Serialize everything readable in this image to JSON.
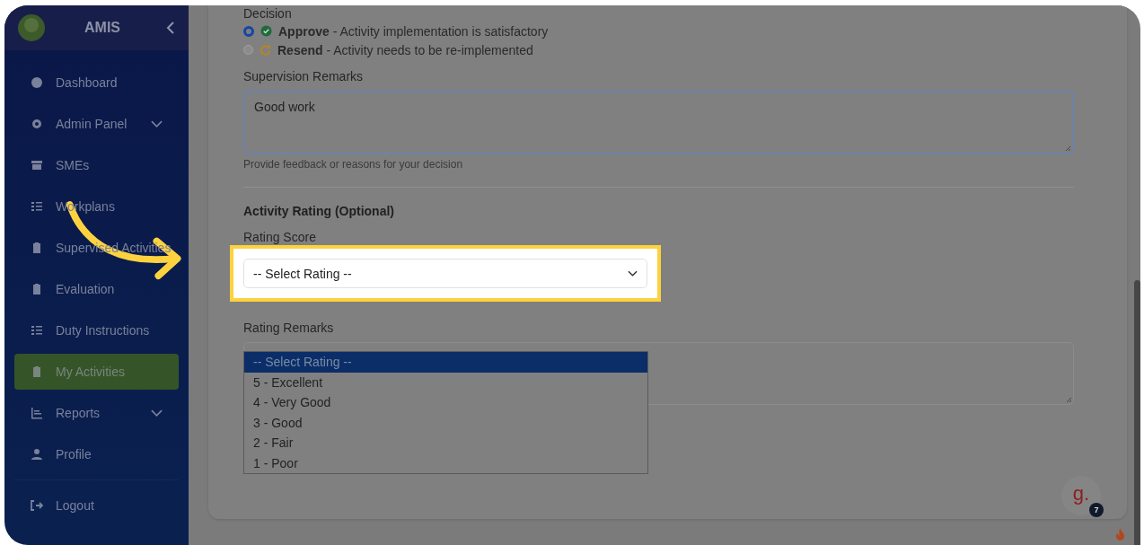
{
  "sidebar": {
    "brand": "AMIS",
    "items": [
      {
        "label": "Dashboard",
        "selected": false,
        "has_submenu": false
      },
      {
        "label": "Admin Panel",
        "selected": false,
        "has_submenu": true
      },
      {
        "label": "SMEs",
        "selected": false,
        "has_submenu": false
      },
      {
        "label": "Workplans",
        "selected": false,
        "has_submenu": false
      },
      {
        "label": "Supervised Activities",
        "selected": false,
        "has_submenu": false
      },
      {
        "label": "Evaluation",
        "selected": false,
        "has_submenu": false
      },
      {
        "label": "Duty Instructions",
        "selected": false,
        "has_submenu": false
      },
      {
        "label": "My Activities",
        "selected": true,
        "has_submenu": false
      },
      {
        "label": "Reports",
        "selected": false,
        "has_submenu": true
      },
      {
        "label": "Profile",
        "selected": false,
        "has_submenu": false
      }
    ],
    "logout": "Logout"
  },
  "decision": {
    "label": "Decision",
    "options": [
      {
        "kind": "approve",
        "text": "**Approve** - Activity implementation is satisfactory",
        "selected": true
      },
      {
        "kind": "resend",
        "text": "**Resend** - Activity needs to be re-implemented",
        "selected": false
      }
    ]
  },
  "supervision_remarks": {
    "label": "Supervision Remarks",
    "value": "Good work",
    "help": "Provide feedback or reasons for your decision"
  },
  "activity_rating": {
    "heading": "Activity Rating (Optional)",
    "rating_score": {
      "label": "Rating Score",
      "value": "-- Select Rating --",
      "options": [
        {
          "label": "-- Select Rating --",
          "selected": true
        },
        {
          "label": "5 - Excellent",
          "selected": false
        },
        {
          "label": "4 - Very Good",
          "selected": false
        },
        {
          "label": "3 - Good",
          "selected": false
        },
        {
          "label": "2 - Fair",
          "selected": false
        },
        {
          "label": "1 - Poor",
          "selected": false
        }
      ]
    },
    "rating_remarks": {
      "label": "Rating Remarks"
    }
  },
  "chat_widget": {
    "logo": "g.",
    "badge": "7"
  }
}
